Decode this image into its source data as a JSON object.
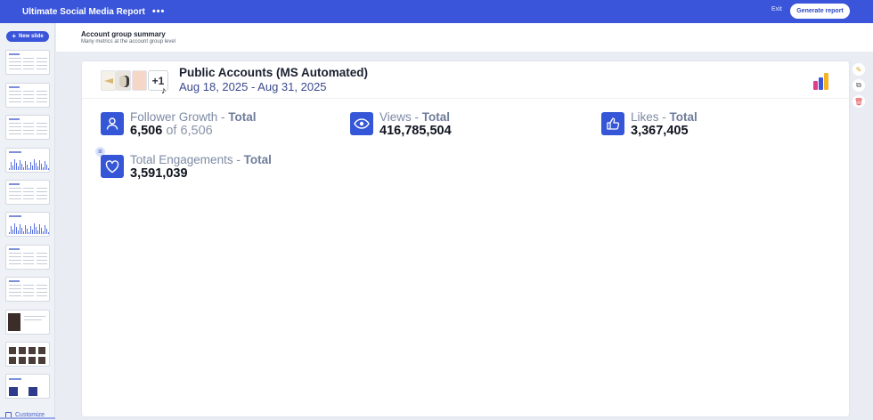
{
  "topbar": {
    "title": "Ultimate Social Media Report",
    "more_label": "•••",
    "exit_label": "Exit",
    "generate_label": "Generate report"
  },
  "sidebar": {
    "new_slide_label": "New slide",
    "customize_label": "Customize"
  },
  "slide_header": {
    "title": "Account group summary",
    "subtitle": "Many metrics at the account group level"
  },
  "card": {
    "group_title": "Public Accounts (MS Automated)",
    "date_range": "Aug 18, 2025 - Aug 31, 2025",
    "more_accounts": "+1",
    "metrics": [
      {
        "name": "Follower Growth",
        "qualifier": "Total",
        "value": "6,506",
        "of_text": "of 6,506",
        "icon": "user-icon"
      },
      {
        "name": "Views",
        "qualifier": "Total",
        "value": "416,785,504",
        "of_text": "",
        "icon": "eye-icon"
      },
      {
        "name": "Likes",
        "qualifier": "Total",
        "value": "3,367,405",
        "of_text": "",
        "icon": "thumbs-up-icon"
      },
      {
        "name": "Total Engagements",
        "qualifier": "Total",
        "value": "3,591,039",
        "of_text": "",
        "icon": "heart-icon"
      }
    ],
    "separator": " - "
  },
  "colors": {
    "brand": "#3a55d9",
    "icon_bg": "#3556d6"
  }
}
